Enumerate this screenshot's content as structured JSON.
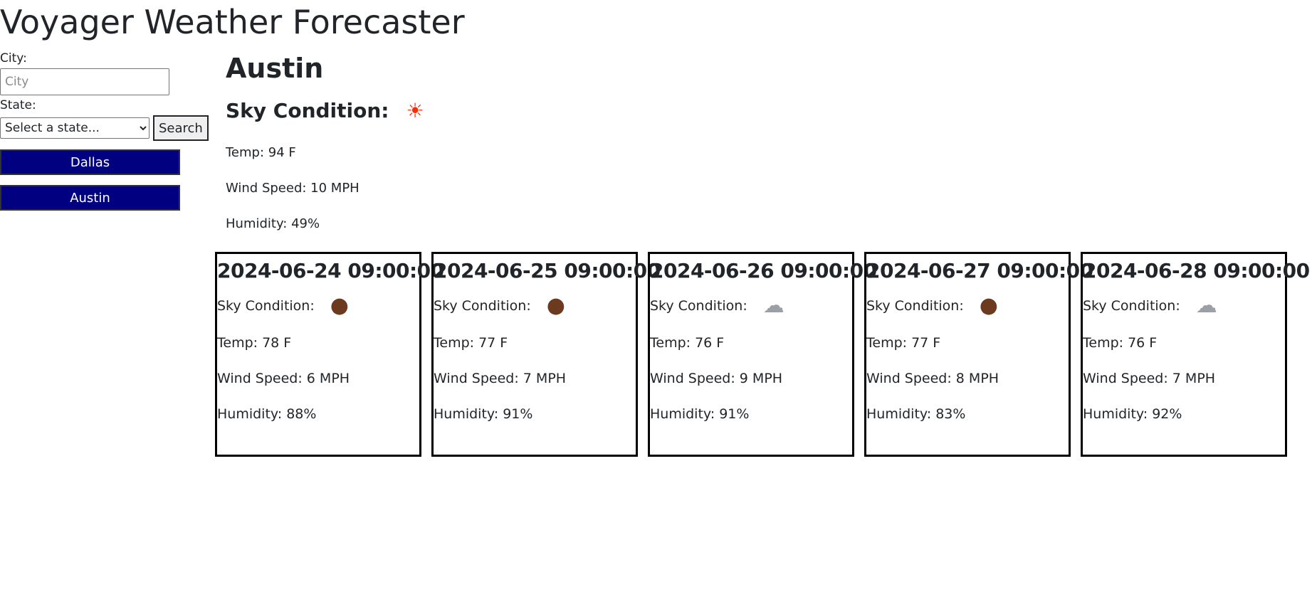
{
  "app": {
    "title": "Voyager Weather Forecaster"
  },
  "search": {
    "city_label": "City:",
    "city_placeholder": "City",
    "city_value": "",
    "state_label": "State:",
    "state_selected": "Select a state...",
    "search_label": "Search"
  },
  "history": [
    {
      "label": "Dallas"
    },
    {
      "label": "Austin"
    }
  ],
  "current": {
    "city": "Austin",
    "sky_label": "Sky Condition:",
    "sky_icon": "sun-icon",
    "temp": "Temp: 94 F",
    "wind": "Wind Speed: 10 MPH",
    "humidity": "Humidity: 49%"
  },
  "forecast": [
    {
      "date": "2024-06-24 09:00:00",
      "sky_label": "Sky Condition:",
      "sky_icon": "night-clouds-icon",
      "temp": "Temp: 78 F",
      "wind": "Wind Speed: 6 MPH",
      "humidity": "Humidity: 88%"
    },
    {
      "date": "2024-06-25 09:00:00",
      "sky_label": "Sky Condition:",
      "sky_icon": "night-clouds-icon",
      "temp": "Temp: 77 F",
      "wind": "Wind Speed: 7 MPH",
      "humidity": "Humidity: 91%"
    },
    {
      "date": "2024-06-26 09:00:00",
      "sky_label": "Sky Condition:",
      "sky_icon": "broken-clouds-icon",
      "temp": "Temp: 76 F",
      "wind": "Wind Speed: 9 MPH",
      "humidity": "Humidity: 91%"
    },
    {
      "date": "2024-06-27 09:00:00",
      "sky_label": "Sky Condition:",
      "sky_icon": "night-clouds-icon",
      "temp": "Temp: 77 F",
      "wind": "Wind Speed: 8 MPH",
      "humidity": "Humidity: 83%"
    },
    {
      "date": "2024-06-28 09:00:00",
      "sky_label": "Sky Condition:",
      "sky_icon": "cloud-icon",
      "temp": "Temp: 76 F",
      "wind": "Wind Speed: 7 MPH",
      "humidity": "Humidity: 92%"
    }
  ],
  "colors": {
    "history_button_bg": "#000080",
    "history_button_text": "#ffffff",
    "card_border": "#000000"
  }
}
